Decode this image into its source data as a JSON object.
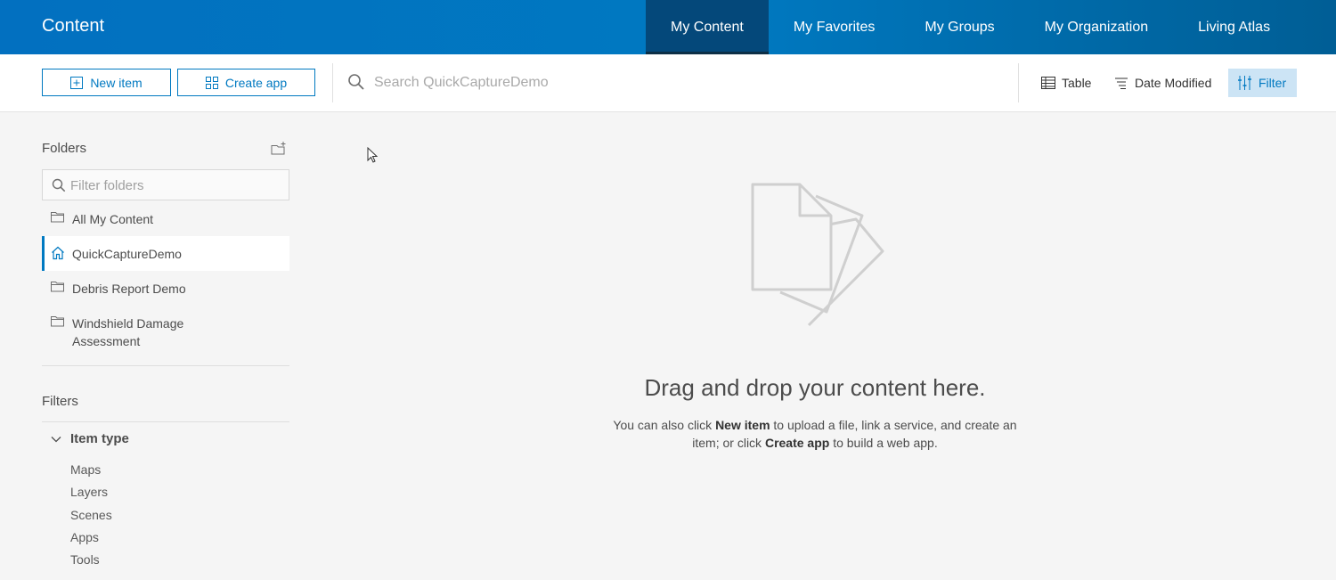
{
  "header": {
    "title": "Content",
    "nav": [
      {
        "label": "My Content",
        "active": true
      },
      {
        "label": "My Favorites",
        "active": false
      },
      {
        "label": "My Groups",
        "active": false
      },
      {
        "label": "My Organization",
        "active": false
      },
      {
        "label": "Living Atlas",
        "active": false
      }
    ]
  },
  "toolbar": {
    "new_item_label": "New item",
    "create_app_label": "Create app",
    "search_placeholder": "Search QuickCaptureDemo",
    "table_label": "Table",
    "sort_label": "Date Modified",
    "filter_label": "Filter"
  },
  "sidebar": {
    "folders_title": "Folders",
    "folder_filter_placeholder": "Filter folders",
    "folders": [
      {
        "label": "All My Content",
        "icon": "folder-icon",
        "active": false
      },
      {
        "label": "QuickCaptureDemo",
        "icon": "home-icon",
        "active": true
      },
      {
        "label": "Debris Report Demo",
        "icon": "folder-icon",
        "active": false
      },
      {
        "label": "Windshield Damage Assessment",
        "icon": "folder-icon",
        "active": false
      }
    ],
    "filters_title": "Filters",
    "item_type_label": "Item type",
    "item_types": [
      "Maps",
      "Layers",
      "Scenes",
      "Apps",
      "Tools"
    ]
  },
  "empty_state": {
    "title": "Drag and drop your content here.",
    "desc_part1": "You can also click ",
    "desc_bold1": "New item",
    "desc_part2": " to upload a file, link a service, and create an item; or click ",
    "desc_bold2": "Create app",
    "desc_part3": " to build a web app."
  },
  "colors": {
    "brand_blue": "#0079c1",
    "header_active": "#04487a",
    "filter_active_bg": "#cce4f5"
  }
}
